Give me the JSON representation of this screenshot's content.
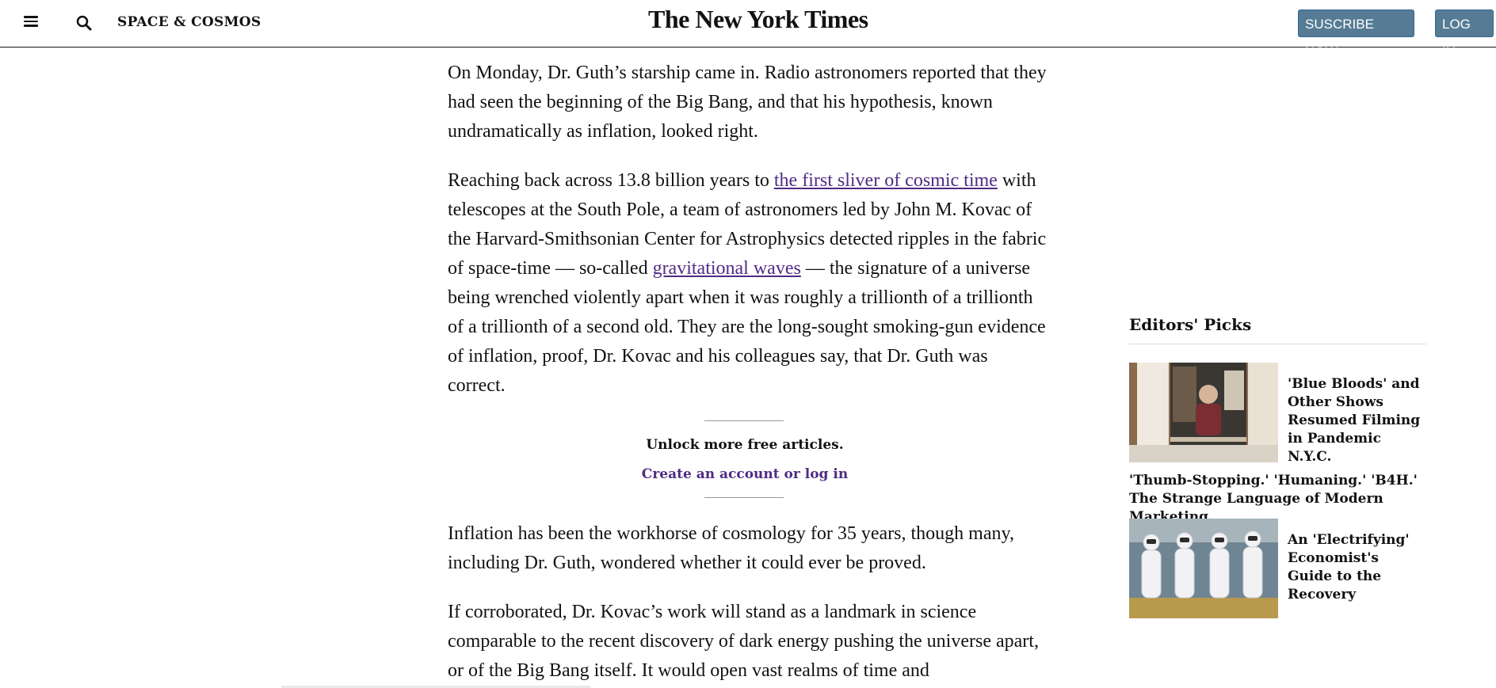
{
  "header": {
    "section": "SPACE & COSMOS",
    "logo": "The New York Times",
    "subscribe_label": "SUSCRIBE NOW",
    "login_label": "LOG IN"
  },
  "article": {
    "p1": "On Monday, Dr. Guth’s starship came in. Radio astronomers reported that they had seen the beginning of the Big Bang, and that his hypothesis, known undramatically as inflation, looked right.",
    "p2_a": "Reaching back across 13.8 billion years to ",
    "p2_link1": "the first sliver of cosmic time",
    "p2_b": " with telescopes at the South Pole, a team of astronomers led by John M. Kovac of the Harvard-Smithsonian Center for Astrophysics detected ripples in the fabric of space-time — so-called ",
    "p2_link2": "gravitational waves",
    "p2_c": " — the signature of a universe being wrenched violently apart when it was roughly a trillionth of a trillionth of a trillionth of a second old. They are the long-sought smoking-gun evidence of inflation, proof, Dr. Kovac and his colleagues say, that Dr. Guth was correct.",
    "unlock_title": "Unlock more free articles.",
    "unlock_link": "Create an account or log in",
    "p3": "Inflation has been the workhorse of cosmology for 35 years, though many, including Dr. Guth, wondered whether it could ever be proved.",
    "p4": "If corroborated, Dr. Kovac’s work will stand as a landmark in science comparable to the recent discovery of dark energy pushing the universe apart, or of the Big Bang itself. It would open vast realms of time and"
  },
  "sidebar": {
    "title": "Editors' Picks",
    "picks": [
      {
        "title": "'Blue Bloods' and Other Shows Resumed Filming in Pandemic N.Y.C.",
        "thumb": "man-at-window-photo"
      },
      {
        "title": "'Thumb-Stopping.' 'Humaning.' 'B4H.' The Strange Language of Modern Marketing."
      },
      {
        "title": "An 'Electrifying' Economist's Guide to the Recovery",
        "thumb": "astronauts-photo"
      }
    ]
  },
  "colors": {
    "link": "#4f2b83",
    "button_bg": "#567b95",
    "text": "#121212"
  }
}
